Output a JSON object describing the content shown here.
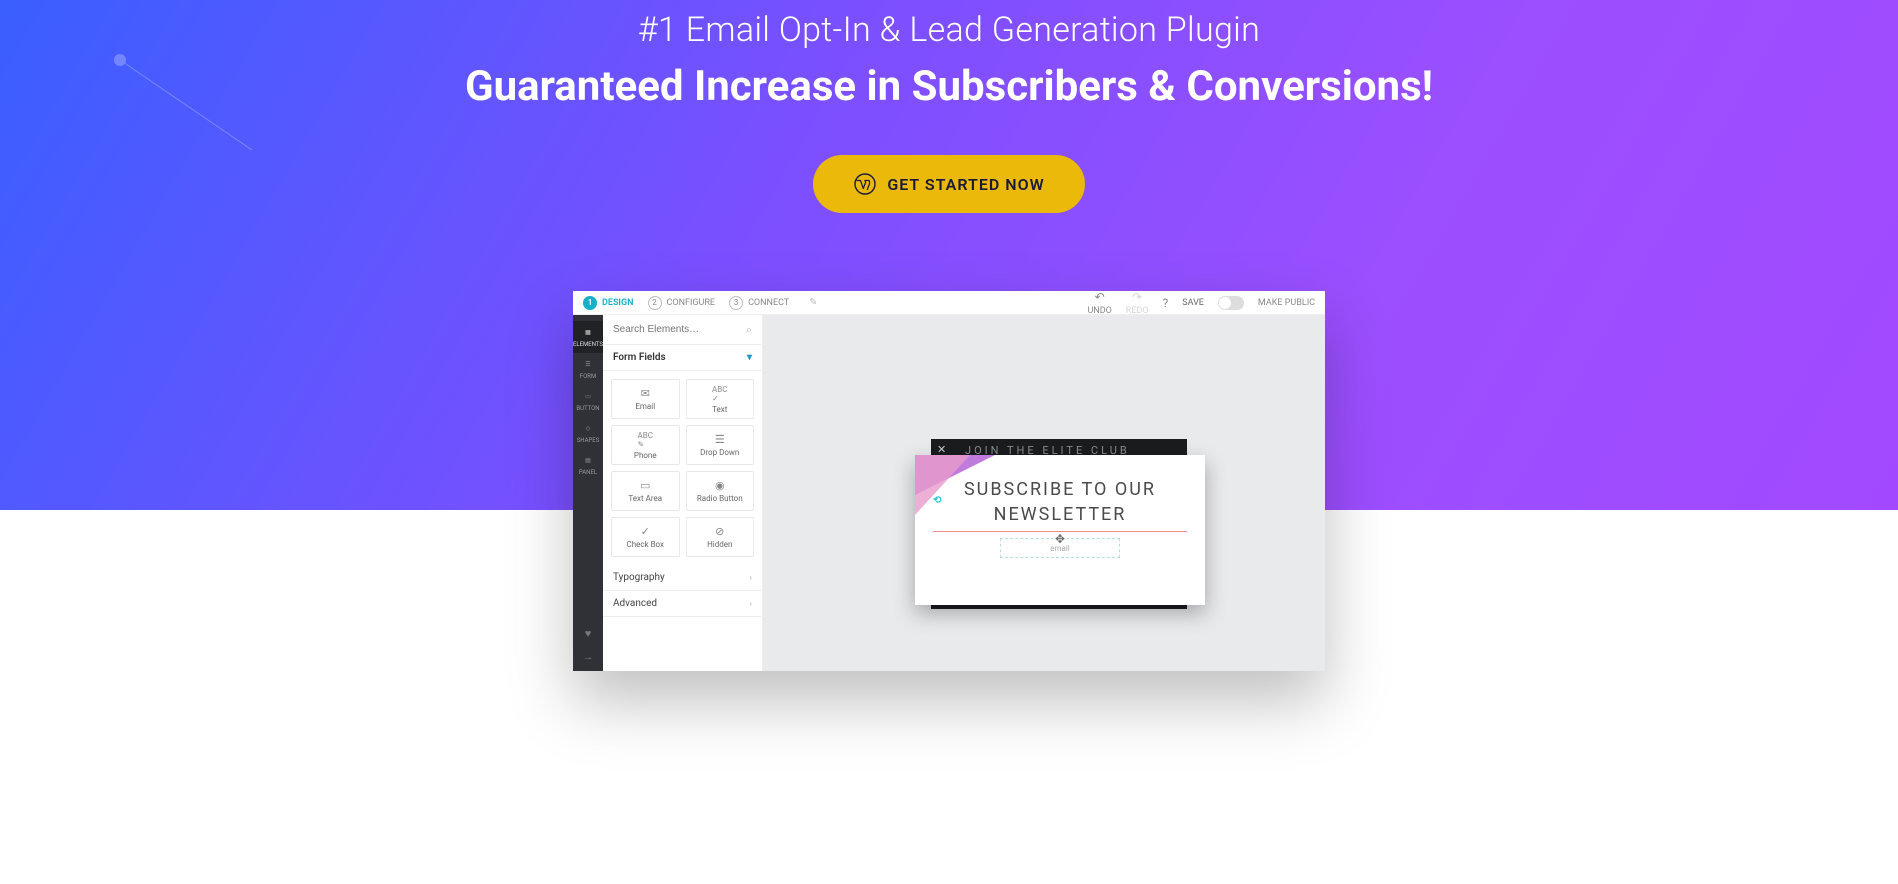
{
  "hero": {
    "subtitle": "#1 Email Opt-In & Lead Generation Plugin",
    "title": "Guaranteed Increase in Subscribers & Conversions!",
    "cta": "GET STARTED NOW"
  },
  "topbar": {
    "steps": [
      {
        "num": "1",
        "label": "DESIGN"
      },
      {
        "num": "2",
        "label": "CONFIGURE"
      },
      {
        "num": "3",
        "label": "CONNECT"
      }
    ],
    "undo": "UNDO",
    "redo": "REDO",
    "help": "?",
    "save": "SAVE",
    "publish": "MAKE PUBLIC"
  },
  "darkbar": {
    "items": [
      {
        "label": "ELEMENTS"
      },
      {
        "label": "FORM"
      },
      {
        "label": "BUTTON"
      },
      {
        "label": "SHAPES"
      },
      {
        "label": "PANEL"
      }
    ]
  },
  "sidepanel": {
    "search_placeholder": "Search Elements…",
    "section": "Form Fields",
    "fields": [
      "Email",
      "Text",
      "Phone",
      "Drop Down",
      "Text Area",
      "Radio Button",
      "Check Box",
      "Hidden"
    ],
    "typography": "Typography",
    "advanced": "Advanced"
  },
  "modal": {
    "back_title": "JOIN THE ELITE CLUB",
    "front_title_1": "SUBSCRIBE TO OUR",
    "front_title_2": "NEWSLETTER",
    "email_label": "email"
  }
}
